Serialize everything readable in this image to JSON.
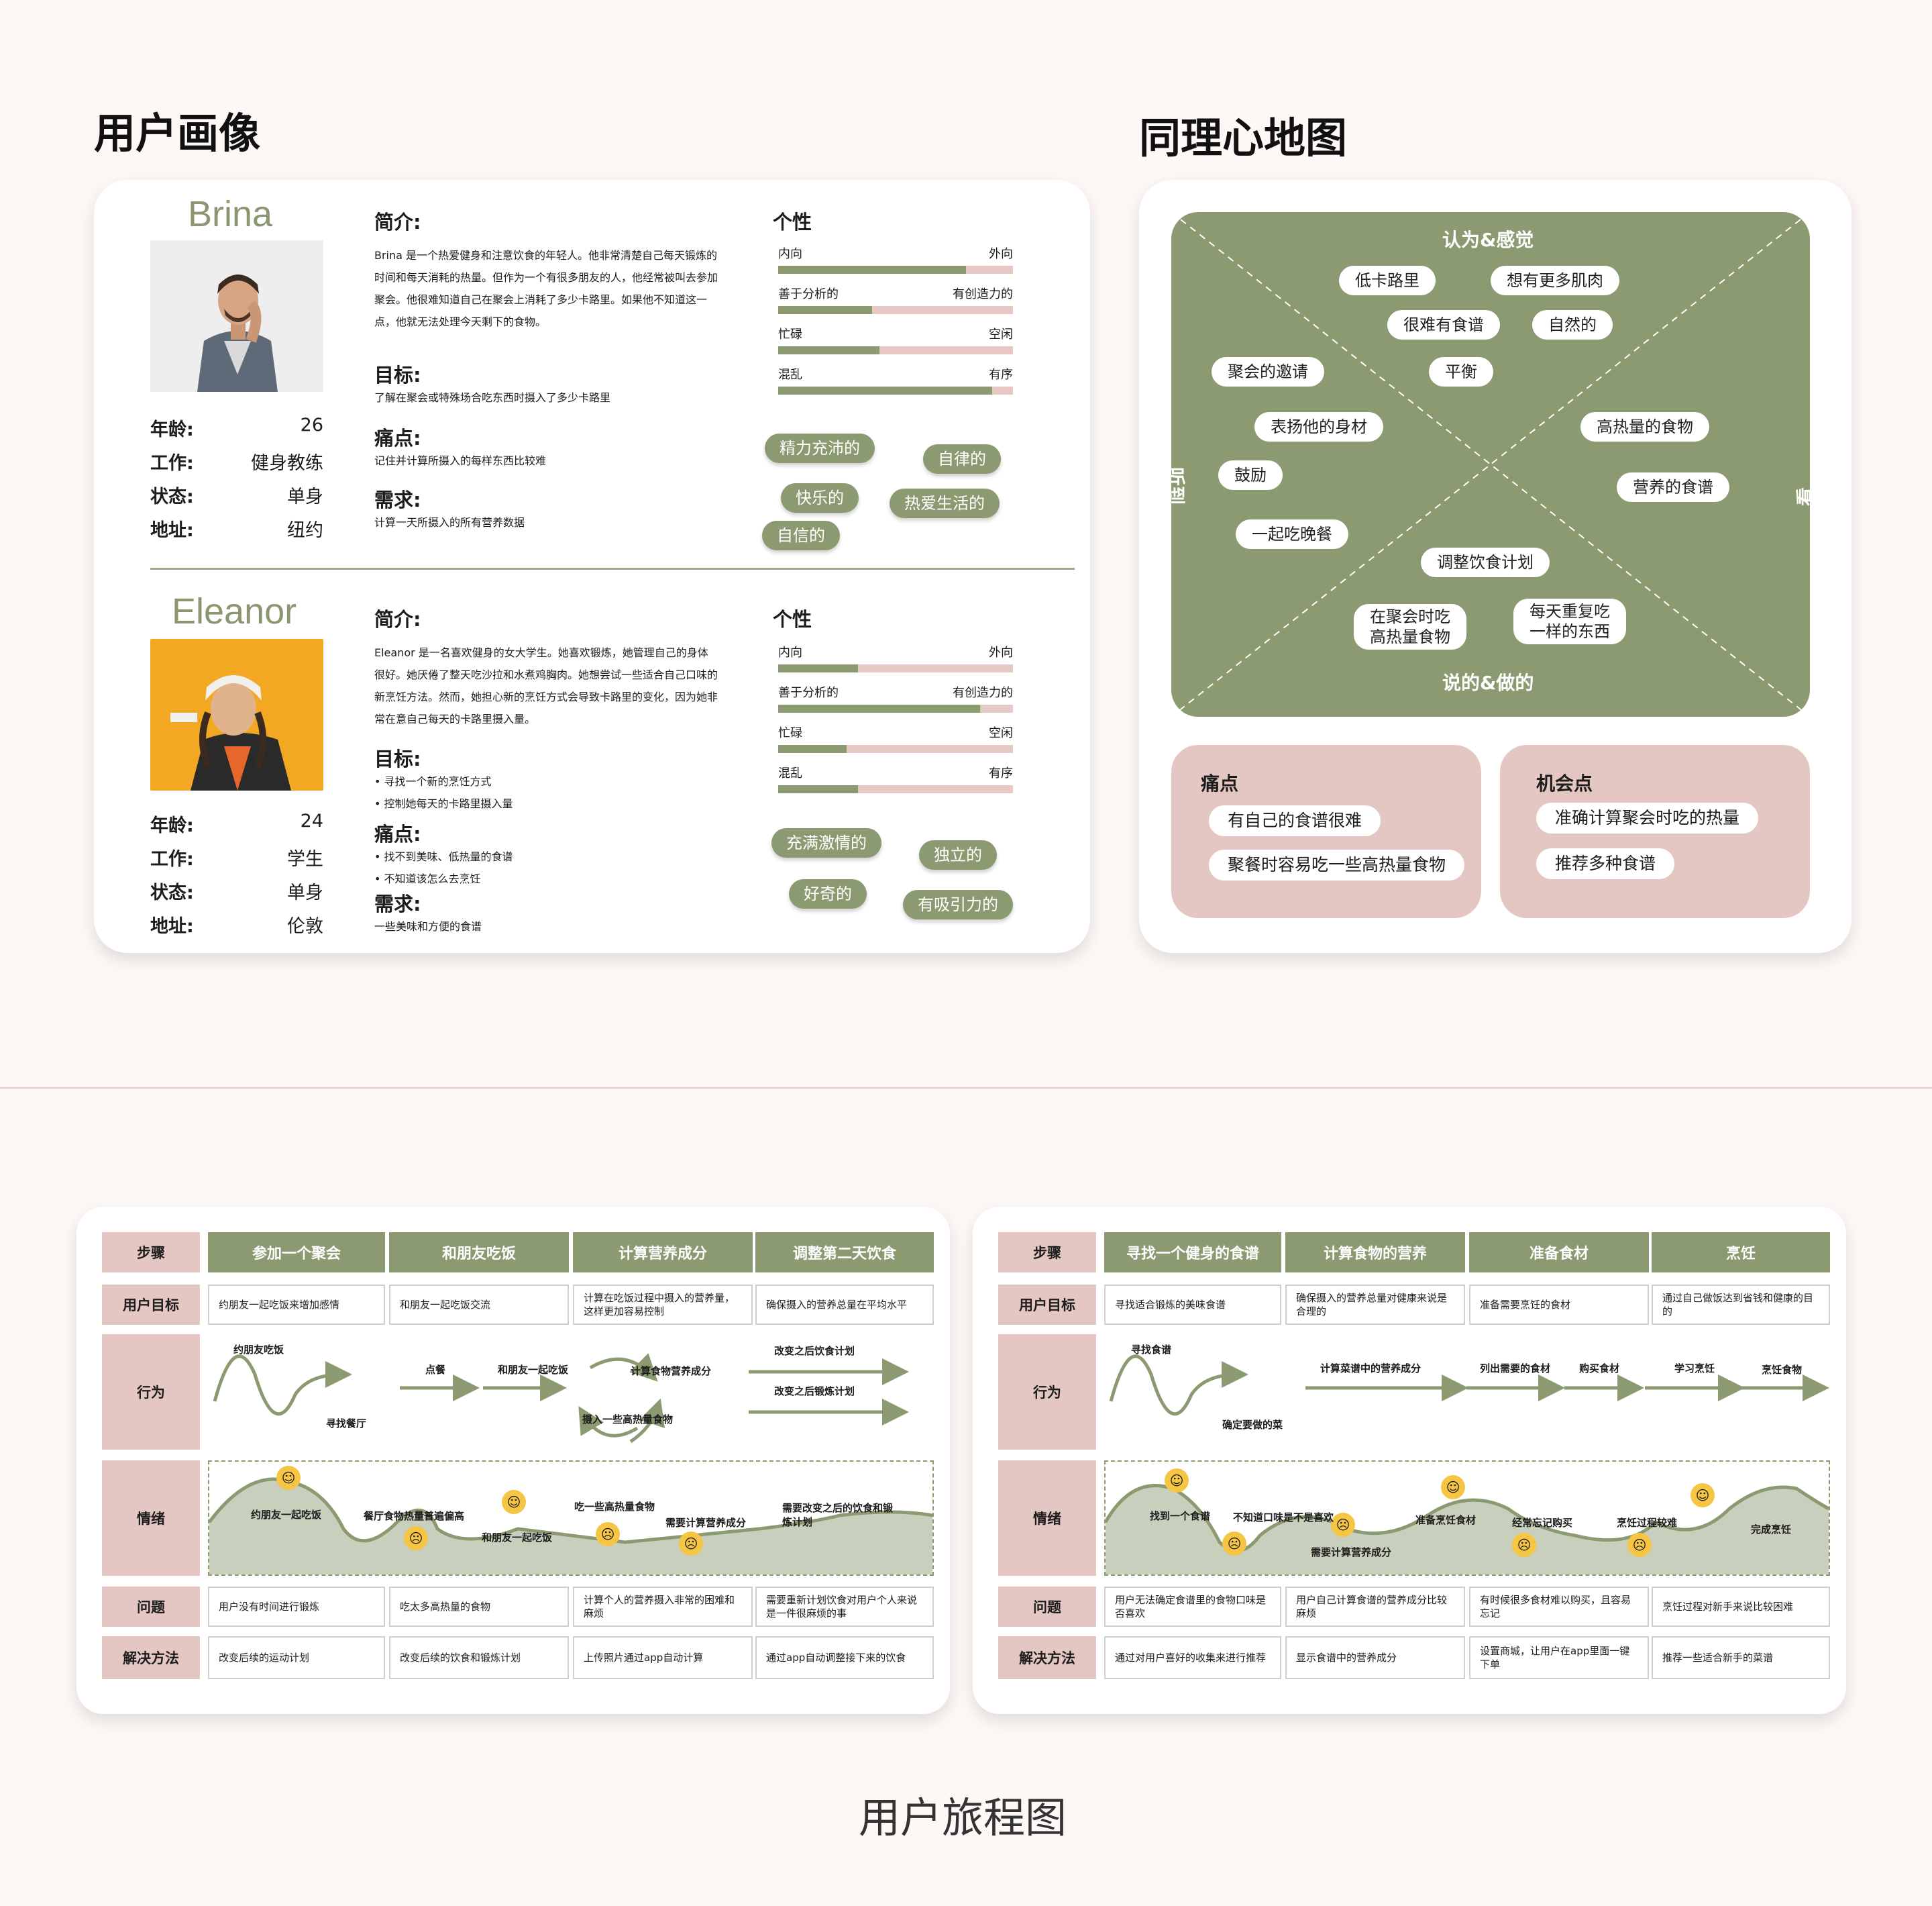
{
  "titles": {
    "persona": "用户画像",
    "empathy": "同理心地图",
    "journey": "用户旅程图"
  },
  "personas": [
    {
      "name": "Brina",
      "info": [
        [
          "年龄:",
          "26"
        ],
        [
          "工作:",
          "健身教练"
        ],
        [
          "状态:",
          "单身"
        ],
        [
          "地址:",
          "纽约"
        ]
      ],
      "intro_title": "简介:",
      "intro_lines": [
        "Brina 是一个热爱健身和注意饮食的年轻人。他非常清楚自己每天锻炼的",
        "时间和每天消耗的热量。但作为一个有很多朋友的人，他经常被叫去参加",
        "聚会。他很难知道自己在聚会上消耗了多少卡路里。如果他不知道这一",
        "点，他就无法处理今天剩下的食物。"
      ],
      "goal_title": "目标:",
      "goal_lines": [
        "了解在聚会或特殊场合吃东西时摄入了多少卡路里"
      ],
      "pain_title": "痛点:",
      "pain_lines": [
        "记住并计算所摄入的每样东西比较难"
      ],
      "need_title": "需求:",
      "need_lines": [
        "计算一天所摄入的所有营养数据"
      ],
      "trait_title": "个性",
      "traits": [
        {
          "left": "内向",
          "right": "外向",
          "value": 0.8
        },
        {
          "left": "善于分析的",
          "right": "有创造力的",
          "value": 0.4
        },
        {
          "left": "忙碌",
          "right": "空闲",
          "value": 0.43
        },
        {
          "left": "混乱",
          "right": "有序",
          "value": 0.91
        }
      ],
      "tags": [
        "精力充沛的",
        "自律的",
        "快乐的",
        "热爱生活的",
        "自信的"
      ]
    },
    {
      "name": "Eleanor",
      "info": [
        [
          "年龄:",
          "24"
        ],
        [
          "工作:",
          "学生"
        ],
        [
          "状态:",
          "单身"
        ],
        [
          "地址:",
          "伦敦"
        ]
      ],
      "intro_title": "简介:",
      "intro_lines": [
        "Eleanor 是一名喜欢健身的女大学生。她喜欢锻炼，她管理自己的身体",
        "很好。她厌倦了整天吃沙拉和水煮鸡胸肉。她想尝试一些适合自己口味的",
        "新烹饪方法。然而，她担心新的烹饪方式会导致卡路里的变化，因为她非",
        "常在意自己每天的卡路里摄入量。"
      ],
      "goal_title": "目标:",
      "goal_lines": [
        "• 寻找一个新的烹饪方式",
        "• 控制她每天的卡路里摄入量"
      ],
      "pain_title": "痛点:",
      "pain_lines": [
        "• 找不到美味、低热量的食谱",
        "• 不知道该怎么去烹饪"
      ],
      "need_title": "需求:",
      "need_lines": [
        "一些美味和方便的食谱"
      ],
      "trait_title": "个性",
      "traits": [
        {
          "left": "内向",
          "right": "外向",
          "value": 0.34
        },
        {
          "left": "善于分析的",
          "right": "有创造力的",
          "value": 0.86
        },
        {
          "left": "忙碌",
          "right": "空闲",
          "value": 0.29
        },
        {
          "left": "混乱",
          "right": "有序",
          "value": 0.34
        }
      ],
      "tags": [
        "充满激情的",
        "独立的",
        "好奇的",
        "有吸引力的"
      ]
    }
  ],
  "empathy": {
    "think_feel": "认为&感觉",
    "say_do": "说的&做的",
    "hear": "听到",
    "see": "看到",
    "bubbles": [
      "低卡路里",
      "想有更多肌肉",
      "很难有食谱",
      "自然的",
      "聚会的邀请",
      "平衡",
      "表扬他的身材",
      "鼓励",
      "高热量的食物",
      "营养的食谱",
      "一起吃晚餐",
      "调整饮食计划"
    ],
    "bubbles_two_line": [
      [
        "在聚会时吃",
        "高热量食物"
      ],
      [
        "每天重复吃",
        "一样的东西"
      ]
    ],
    "pain_title": "痛点",
    "pains": [
      "有自己的食谱很难",
      "聚餐时容易吃一些高热量食物"
    ],
    "opp_title": "机会点",
    "opps": [
      "准确计算聚会时吃的热量",
      "推荐多种食谱"
    ]
  },
  "journeys": [
    {
      "row_labels": [
        "步骤",
        "用户目标",
        "行为",
        "情绪",
        "问题",
        "解决方法"
      ],
      "steps": [
        "参加一个聚会",
        "和朋友吃饭",
        "计算营养成分",
        "调整第二天饮食"
      ],
      "goals": [
        "约朋友一起吃饭来增加感情",
        "和朋友一起吃饭交流",
        "计算在吃饭过程中摄入的营养量，这样更加容易控制",
        "确保摄入的营养总量在平均水平"
      ],
      "actions": [
        "约朋友吃饭",
        "寻找餐厅",
        "点餐",
        "和朋友一起吃饭",
        "计算食物营养成分",
        "摄入一些高热量食物",
        "改变之后饮食计划",
        "改变之后锻炼计划"
      ],
      "emotions": [
        "约朋友一起吃饭",
        "餐厅食物热量普遍偏高",
        "和朋友一起吃饭",
        "吃一些高热量食物",
        "需要计算营养成分",
        "需要改变之后的饮食和锻炼计划"
      ],
      "problems": [
        "用户没有时间进行锻炼",
        "吃太多高热量的食物",
        "计算个人的营养摄入非常的困难和麻烦",
        "需要重新计划饮食对用户个人来说是一件很麻烦的事"
      ],
      "solutions": [
        "改变后续的运动计划",
        "改变后续的饮食和锻炼计划",
        "上传照片通过app自动计算",
        "通过app自动调整接下来的饮食"
      ]
    },
    {
      "row_labels": [
        "步骤",
        "用户目标",
        "行为",
        "情绪",
        "问题",
        "解决方法"
      ],
      "steps": [
        "寻找一个健身的食谱",
        "计算食物的营养",
        "准备食材",
        "烹饪"
      ],
      "goals": [
        "寻找适合锻炼的美味食谱",
        "确保摄入的营养总量对健康来说是合理的",
        "准备需要烹饪的食材",
        "通过自己做饭达到省钱和健康的目的"
      ],
      "actions": [
        "寻找食谱",
        "确定要做的菜",
        "计算菜谱中的营养成分",
        "列出需要的食材",
        "购买食材",
        "学习烹饪",
        "烹饪食物"
      ],
      "emotions": [
        "找到一个食谱",
        "不知道口味是不是喜欢",
        "需要计算营养成分",
        "准备烹饪食材",
        "经常忘记购买",
        "烹饪过程较难",
        "完成烹饪"
      ],
      "problems": [
        "用户无法确定食谱里的食物口味是否喜欢",
        "用户自己计算食谱的营养成分比较麻烦",
        "有时候很多食材难以购买，且容易忘记",
        "烹饪过程对新手来说比较困难"
      ],
      "solutions": [
        "通过对用户喜好的收集来进行推荐",
        "显示食谱中的营养成分",
        "设置商城，让用户在app里面一键下单",
        "推荐一些适合新手的菜谱"
      ]
    }
  ],
  "colors": {
    "olive": "#8b9a71",
    "pink": "#e4c7c2",
    "emoji": "#f6c543"
  }
}
